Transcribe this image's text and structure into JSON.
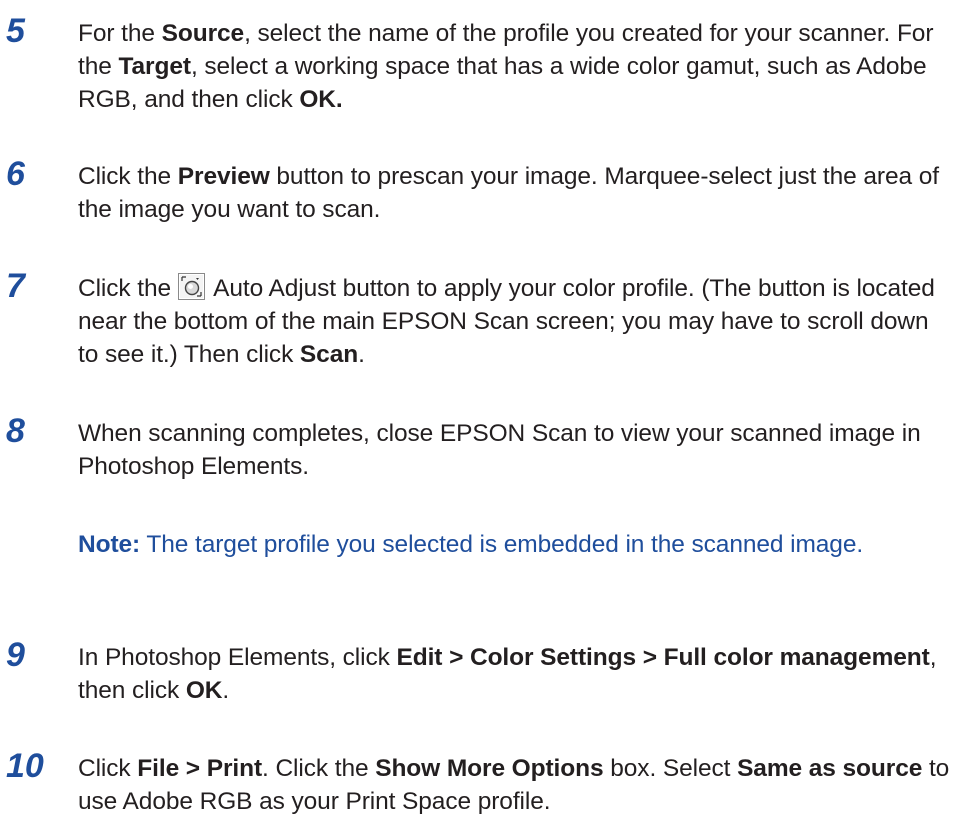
{
  "steps": [
    {
      "number": "5",
      "parts": [
        {
          "t": "For the "
        },
        {
          "t": "Source",
          "b": true
        },
        {
          "t": ", select the name of the profile you created for your scanner. For the "
        },
        {
          "t": "Target",
          "b": true
        },
        {
          "t": ", select a working space that has a wide color gamut, such as Adobe RGB, and then click "
        },
        {
          "t": "OK.",
          "b": true
        }
      ]
    },
    {
      "number": "6",
      "parts": [
        {
          "t": "Click the "
        },
        {
          "t": "Preview",
          "b": true
        },
        {
          "t": " button to prescan your image. Marquee-select just the area of the image you want to scan."
        }
      ]
    },
    {
      "number": "7",
      "parts": [
        {
          "t": "Click the "
        },
        {
          "icon": "auto-adjust-icon"
        },
        {
          "t": " Auto Adjust button to apply your color profile. (The button is located near the bottom of the main EPSON Scan screen; you may have to scroll down to see it.) Then click "
        },
        {
          "t": "Scan",
          "b": true
        },
        {
          "t": "."
        }
      ]
    },
    {
      "number": "8",
      "parts": [
        {
          "t": "When scanning completes, close EPSON Scan to view your scanned image in Photoshop Elements."
        }
      ]
    },
    {
      "number": "9",
      "parts": [
        {
          "t": "In Photoshop Elements, click "
        },
        {
          "t": "Edit > Color Settings > Full color management",
          "b": true
        },
        {
          "t": ", then click "
        },
        {
          "t": "OK",
          "b": true
        },
        {
          "t": "."
        }
      ]
    },
    {
      "number": "10",
      "parts": [
        {
          "t": "Click "
        },
        {
          "t": "File > Print",
          "b": true
        },
        {
          "t": ". Click the "
        },
        {
          "t": "Show More Options",
          "b": true
        },
        {
          "t": " box. Select "
        },
        {
          "t": "Same as source",
          "b": true
        },
        {
          "t": " to use Adobe RGB as your Print Space profile."
        }
      ]
    }
  ],
  "note": {
    "label": "Note:",
    "text": " The target profile you selected is embedded in the scanned image."
  },
  "colors": {
    "accent": "#1f4e9c",
    "text": "#231f20"
  }
}
